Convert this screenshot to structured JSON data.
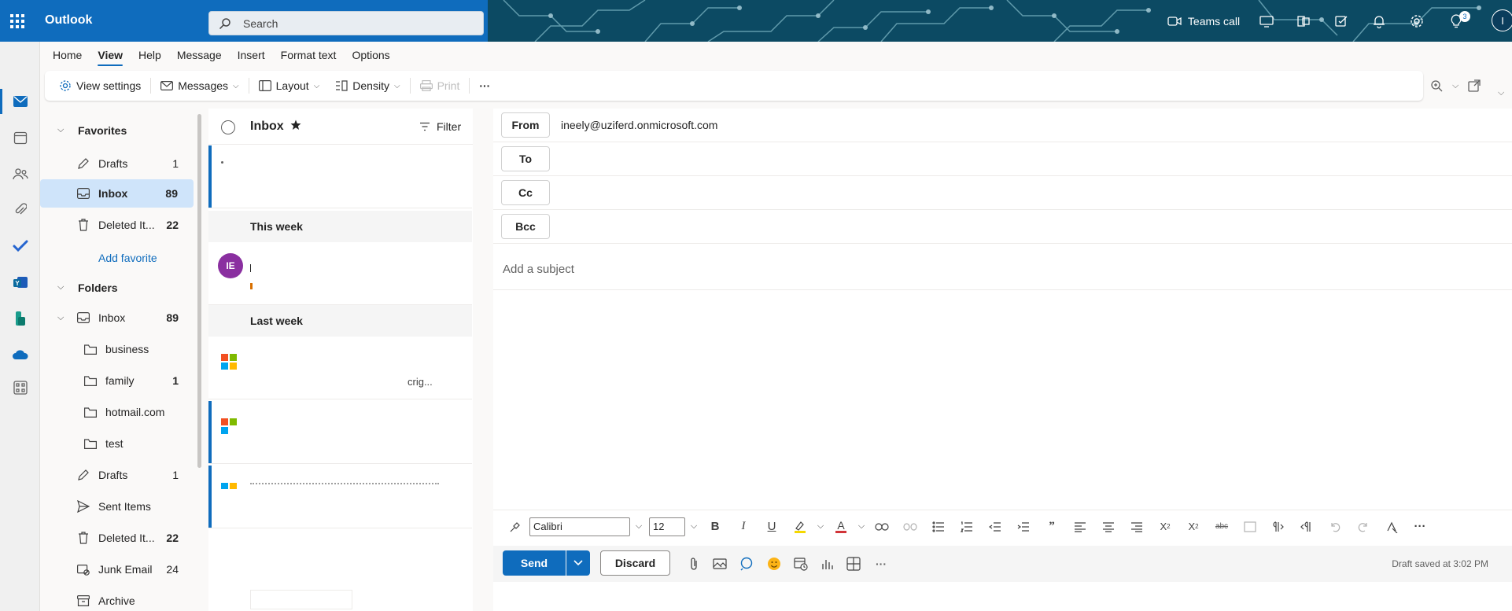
{
  "app": {
    "name": "Outlook"
  },
  "topbar": {
    "search_placeholder": "Search",
    "teams_call": "Teams call",
    "notification_badge": "3",
    "avatar_initial": "I"
  },
  "tabs": [
    "Home",
    "View",
    "Help",
    "Message",
    "Insert",
    "Format text",
    "Options"
  ],
  "active_tab": "View",
  "ribbon": {
    "view_settings": "View settings",
    "messages": "Messages",
    "layout": "Layout",
    "density": "Density",
    "print": "Print",
    "more": "···"
  },
  "folders": {
    "favorites_header": "Favorites",
    "favorites": [
      {
        "label": "Drafts",
        "count": "1"
      },
      {
        "label": "Inbox",
        "count": "89"
      },
      {
        "label": "Deleted It...",
        "count": "22"
      }
    ],
    "add_favorite": "Add favorite",
    "folders_header": "Folders",
    "inbox": {
      "label": "Inbox",
      "count": "89"
    },
    "subfolders": [
      {
        "label": "business",
        "count": ""
      },
      {
        "label": "family",
        "count": "1"
      },
      {
        "label": "hotmail.com",
        "count": ""
      },
      {
        "label": "test",
        "count": ""
      }
    ],
    "others": [
      {
        "label": "Drafts",
        "count": "1"
      },
      {
        "label": "Sent Items",
        "count": ""
      },
      {
        "label": "Deleted It...",
        "count": "22"
      },
      {
        "label": "Junk Email",
        "count": "24"
      },
      {
        "label": "Archive",
        "count": ""
      }
    ]
  },
  "message_list": {
    "title": "Inbox",
    "filter": "Filter",
    "groups": [
      "This week",
      "Last week"
    ],
    "item_initials": "IE",
    "snippet_fragment": "crig..."
  },
  "compose": {
    "from_label": "From",
    "from_value": "ineely@uziferd.onmicrosoft.com",
    "to_label": "To",
    "cc_label": "Cc",
    "bcc_label": "Bcc",
    "subject_placeholder": "Add a subject",
    "font": "Calibri",
    "font_size": "12",
    "send": "Send",
    "discard": "Discard",
    "draft_status": "Draft saved at 3:02 PM",
    "more": "···"
  },
  "colors": {
    "accent": "#0f6cbd",
    "selection": "#cfe4fa",
    "avatar_purple": "#8a2fa0"
  }
}
